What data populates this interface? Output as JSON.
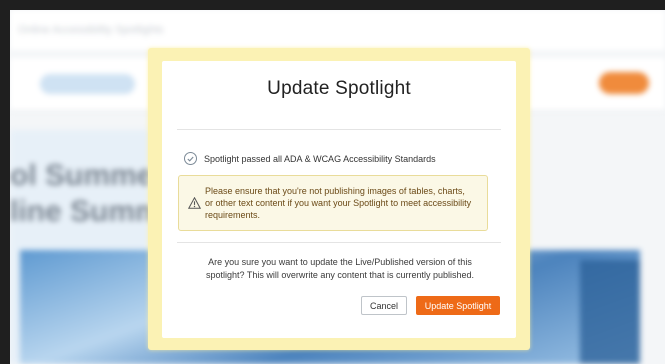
{
  "background": {
    "topbar_text": "Online Accessibility Spotlights",
    "heading": "ol Summer\nline Summe"
  },
  "modal": {
    "title": "Update Spotlight",
    "pass_icon": "check-circle-icon",
    "pass_text": "Spotlight passed all ADA & WCAG Accessibility Standards",
    "warning_icon": "warning-triangle-icon",
    "warning_text": "Please ensure that you're not publishing images of tables, charts, or other text content if you want your Spotlight to meet accessibility requirements.",
    "confirm_text": "Are you sure you want to update the Live/Published version of this spotlight? This will overwrite any content that is currently published.",
    "cancel_label": "Cancel",
    "update_label": "Update Spotlight"
  },
  "colors": {
    "accent": "#ee6a17",
    "modal_frame": "#fbf2b4",
    "warning_bg": "#fbf8e6",
    "warning_text": "#6b4a17"
  }
}
